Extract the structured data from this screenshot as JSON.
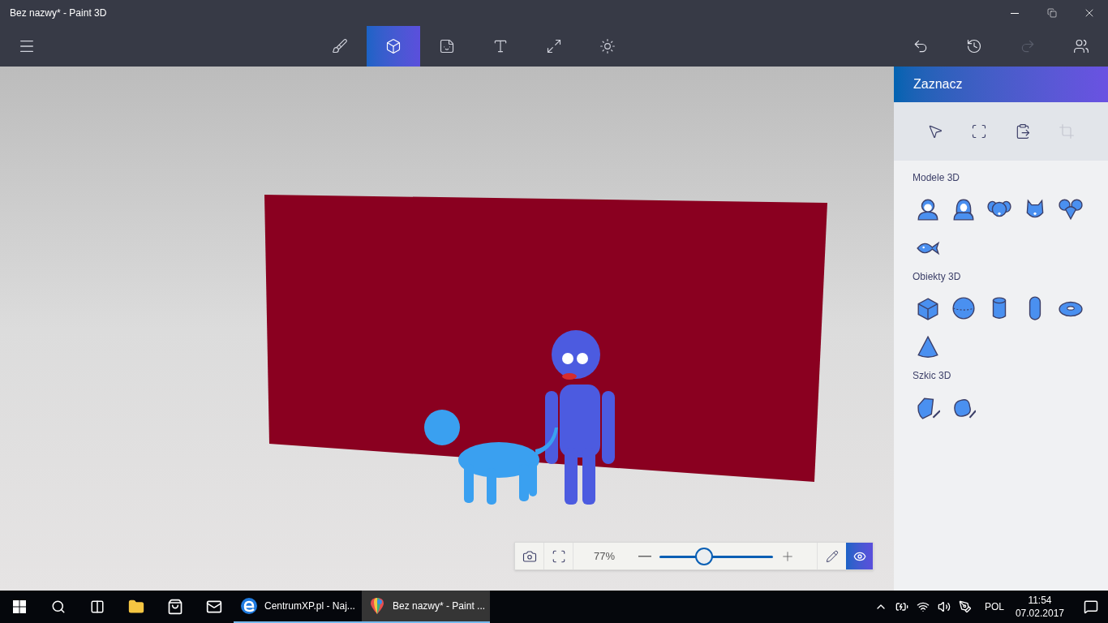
{
  "window": {
    "title": "Bez nazwy* - Paint 3D"
  },
  "toolbar": {
    "tools": [
      {
        "kind": "brush",
        "selected": false
      },
      {
        "kind": "cube",
        "selected": true
      },
      {
        "kind": "sticker",
        "selected": false
      },
      {
        "kind": "text",
        "selected": false
      },
      {
        "kind": "canvas",
        "selected": false
      },
      {
        "kind": "effects",
        "selected": false
      }
    ],
    "history": [
      {
        "kind": "undo",
        "disabled": false
      },
      {
        "kind": "history",
        "disabled": false
      },
      {
        "kind": "redo",
        "disabled": true
      },
      {
        "kind": "remix",
        "disabled": false
      }
    ]
  },
  "panel": {
    "title": "Zaznacz",
    "select_tools": [
      {
        "kind": "pointer",
        "disabled": false
      },
      {
        "kind": "marquee",
        "disabled": false
      },
      {
        "kind": "paste",
        "disabled": false
      },
      {
        "kind": "crop",
        "disabled": true
      }
    ],
    "sections": [
      {
        "title": "Modele 3D",
        "items": [
          {
            "kind": "man"
          },
          {
            "kind": "woman"
          },
          {
            "kind": "dog"
          },
          {
            "kind": "cat"
          },
          {
            "kind": "mouse"
          },
          {
            "kind": "fish"
          }
        ]
      },
      {
        "title": "Obiekty 3D",
        "items": [
          {
            "kind": "cube"
          },
          {
            "kind": "sphere"
          },
          {
            "kind": "cylinder"
          },
          {
            "kind": "capsule"
          },
          {
            "kind": "torus"
          },
          {
            "kind": "cone"
          }
        ]
      },
      {
        "title": "Szkic 3D",
        "items": [
          {
            "kind": "sharp"
          },
          {
            "kind": "soft"
          }
        ]
      }
    ]
  },
  "zoom_bar": {
    "reading": "77%",
    "level": 0.39,
    "view_active": true
  },
  "taskbar": {
    "apps": [
      {
        "kind": "search",
        "running": false,
        "selected": false
      },
      {
        "kind": "taskview",
        "running": false,
        "selected": false
      },
      {
        "kind": "folder",
        "running": false,
        "selected": false
      },
      {
        "kind": "store",
        "running": false,
        "selected": false
      },
      {
        "kind": "mail",
        "running": false,
        "selected": false
      },
      {
        "kind": "edge",
        "label": "CentrumXP.pl - Naj...",
        "running": true,
        "selected": false
      },
      {
        "kind": "paint",
        "label": "Bez nazwy* - Paint ...",
        "running": true,
        "selected": true
      }
    ],
    "language": "POL",
    "time": "11:54",
    "date": "07.02.2017"
  }
}
